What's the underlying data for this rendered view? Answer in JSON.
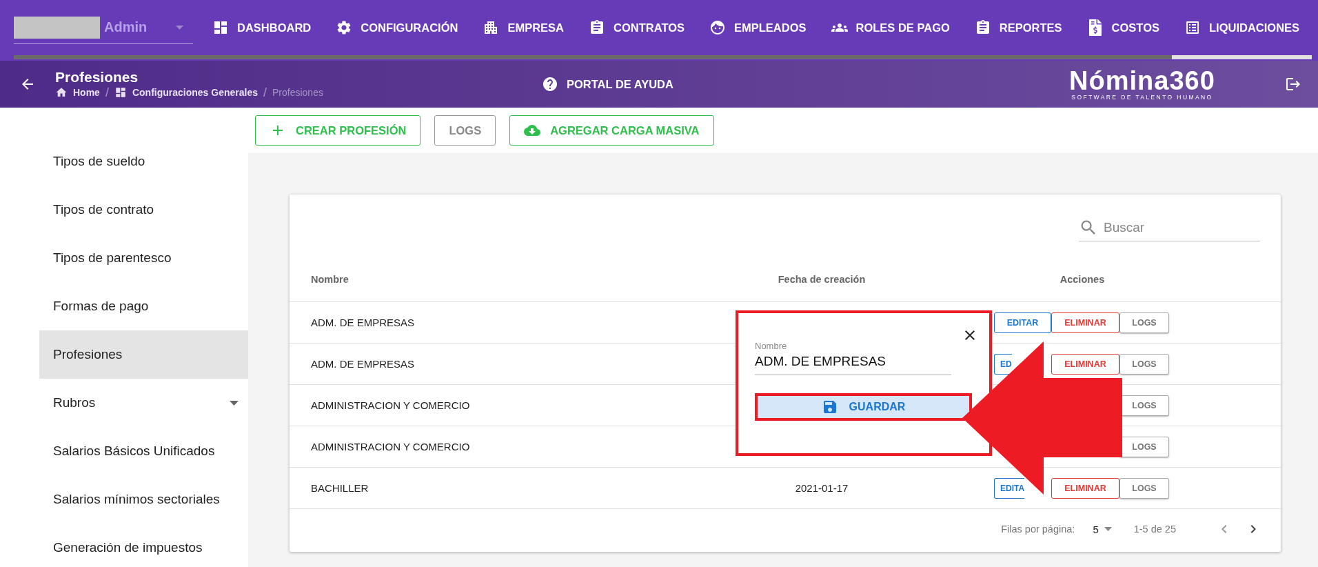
{
  "user": {
    "name": "Admin"
  },
  "nav": [
    {
      "label": "DASHBOARD",
      "selected": false
    },
    {
      "label": "CONFIGURACIÓN",
      "selected": false
    },
    {
      "label": "EMPRESA",
      "selected": false
    },
    {
      "label": "CONTRATOS",
      "selected": false
    },
    {
      "label": "EMPLEADOS",
      "selected": false
    },
    {
      "label": "ROLES DE PAGO",
      "selected": false
    },
    {
      "label": "REPORTES",
      "selected": false
    },
    {
      "label": "COSTOS",
      "selected": false
    },
    {
      "label": "LIQUIDACIONES",
      "selected": true
    }
  ],
  "page": {
    "title": "Profesiones",
    "breadcrumbs": [
      "Home",
      "Configuraciones Generales",
      "Profesiones"
    ],
    "breadcrumb_separator": "/"
  },
  "help": "PORTAL DE AYUDA",
  "logo": {
    "name": "Nómina360",
    "tagline": "SOFTWARE DE TALENTO HUMANO"
  },
  "sidebar": [
    {
      "label": "Tipos de sueldo",
      "selected": false,
      "expandable": false
    },
    {
      "label": "Tipos de contrato",
      "selected": false,
      "expandable": false
    },
    {
      "label": "Tipos de parentesco",
      "selected": false,
      "expandable": false
    },
    {
      "label": "Formas de pago",
      "selected": false,
      "expandable": false
    },
    {
      "label": "Profesiones",
      "selected": true,
      "expandable": false
    },
    {
      "label": "Rubros",
      "selected": false,
      "expandable": true
    },
    {
      "label": "Salarios Básicos Unificados",
      "selected": false,
      "expandable": false
    },
    {
      "label": "Salarios mínimos sectoriales",
      "selected": false,
      "expandable": false
    },
    {
      "label": "Generación de impuestos",
      "selected": false,
      "expandable": false
    }
  ],
  "toolbar": [
    {
      "label": "CREAR PROFESIÓN",
      "kind": "create"
    },
    {
      "label": "LOGS",
      "kind": "plain"
    },
    {
      "label": "AGREGAR CARGA MASIVA",
      "kind": "upload"
    }
  ],
  "table": {
    "search_placeholder": "Buscar",
    "columns": [
      "Nombre",
      "Fecha de creación",
      "Acciones"
    ],
    "rows": [
      {
        "name": "ADM. DE EMPRESAS",
        "actions": [
          {
            "kind": "edit",
            "label": "EDITAR",
            "cut": false
          },
          {
            "kind": "delete",
            "label": "ELIMINAR",
            "cut": false
          },
          {
            "kind": "logs",
            "label": "LOGS",
            "cut": false
          }
        ]
      },
      {
        "name": "ADM. DE EMPRESAS",
        "actions": [
          {
            "kind": "edit",
            "label": "ED",
            "cut": true
          },
          {
            "kind": "delete",
            "label": "ELIMINAR",
            "cut": false
          },
          {
            "kind": "logs",
            "label": "LOGS",
            "cut": false
          }
        ]
      },
      {
        "name": "ADMINISTRACION Y COMERCIO",
        "actions": [
          {
            "kind": "logs",
            "label": "LOGS",
            "cut": false
          }
        ]
      },
      {
        "name": "ADMINISTRACION Y COMERCIO",
        "actions": [
          {
            "kind": "logs",
            "label": "LOGS",
            "cut": false
          }
        ]
      },
      {
        "name": "BACHILLER",
        "date": "2021-01-17",
        "actions": [
          {
            "kind": "edit",
            "label": "EDITA",
            "cut": true
          },
          {
            "kind": "delete",
            "label": "ELIMINAR",
            "cut": false
          },
          {
            "kind": "logs",
            "label": "LOGS",
            "cut": false
          }
        ]
      }
    ]
  },
  "pagination": {
    "rows_label": "Filas por página:",
    "rows_value": "5",
    "range": "1-5 de 25"
  },
  "dialog": {
    "field_label": "Nombre",
    "value": "ADM. DE EMPRESAS",
    "save": "GUARDAR"
  }
}
